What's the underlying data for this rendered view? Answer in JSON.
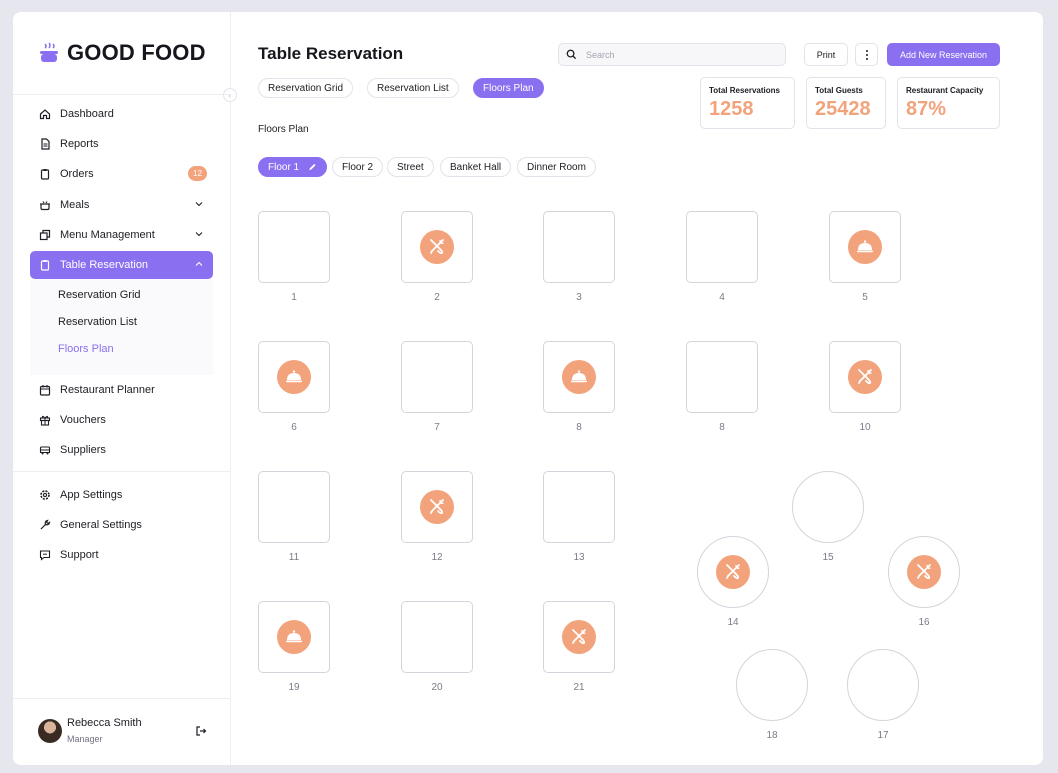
{
  "brand": {
    "name": "GOOD FOOD"
  },
  "sidebar": {
    "items": [
      {
        "label": "Dashboard",
        "icon": "home-icon"
      },
      {
        "label": "Reports",
        "icon": "file-icon"
      },
      {
        "label": "Orders",
        "icon": "clipboard-icon",
        "badge": "12"
      },
      {
        "label": "Meals",
        "icon": "pot-icon"
      },
      {
        "label": "Menu Management",
        "icon": "copy-icon"
      },
      {
        "label": "Table Reservation",
        "icon": "clipboard-icon",
        "active": true
      },
      {
        "label": "Restaurant Planner",
        "icon": "calendar-icon"
      },
      {
        "label": "Vouchers",
        "icon": "gift-icon"
      },
      {
        "label": "Suppliers",
        "icon": "truck-icon"
      },
      {
        "label": "App Settings",
        "icon": "gear-icon"
      },
      {
        "label": "General Settings",
        "icon": "wrench-icon"
      },
      {
        "label": "Support",
        "icon": "chat-icon"
      }
    ],
    "submenu": [
      {
        "label": "Reservation Grid"
      },
      {
        "label": "Reservation List"
      },
      {
        "label": "Floors Plan",
        "active": true
      }
    ]
  },
  "user": {
    "name": "Rebecca Smith",
    "role": "Manager"
  },
  "header": {
    "title": "Table Reservation",
    "search_placeholder": "Search",
    "print_label": "Print",
    "add_label": "Add New Reservation"
  },
  "view_tabs": [
    "Reservation Grid",
    "Reservation List",
    "Floors Plan"
  ],
  "active_view": "Floors Plan",
  "stats": [
    {
      "label": "Total Reservations",
      "value": "1258"
    },
    {
      "label": "Total Guests",
      "value": "25428"
    },
    {
      "label": "Restaurant Capacity",
      "value": "87%"
    }
  ],
  "section_label": "Floors Plan",
  "floors": [
    "Floor 1",
    "Floor 2",
    "Street",
    "Banket Hall",
    "Dinner Room"
  ],
  "active_floor": "Floor 1",
  "colors": {
    "accent": "#8a6ff0",
    "orange": "#f2a37c"
  },
  "tables": [
    {
      "label": "1",
      "shape": "square",
      "status": "free"
    },
    {
      "label": "2",
      "shape": "square",
      "status": "utensils"
    },
    {
      "label": "3",
      "shape": "square",
      "status": "free"
    },
    {
      "label": "4",
      "shape": "square",
      "status": "free"
    },
    {
      "label": "5",
      "shape": "square",
      "status": "cloche"
    },
    {
      "label": "6",
      "shape": "square",
      "status": "cloche"
    },
    {
      "label": "7",
      "shape": "square",
      "status": "free"
    },
    {
      "label": "8",
      "shape": "square",
      "status": "cloche"
    },
    {
      "label": "8",
      "shape": "square",
      "status": "free"
    },
    {
      "label": "10",
      "shape": "square",
      "status": "utensils"
    },
    {
      "label": "11",
      "shape": "square",
      "status": "free"
    },
    {
      "label": "12",
      "shape": "square",
      "status": "utensils"
    },
    {
      "label": "13",
      "shape": "square",
      "status": "free"
    },
    {
      "label": "19",
      "shape": "square",
      "status": "cloche"
    },
    {
      "label": "20",
      "shape": "square",
      "status": "free"
    },
    {
      "label": "21",
      "shape": "square",
      "status": "utensils"
    },
    {
      "label": "15",
      "shape": "round",
      "status": "free"
    },
    {
      "label": "14",
      "shape": "round",
      "status": "utensils"
    },
    {
      "label": "16",
      "shape": "round",
      "status": "utensils"
    },
    {
      "label": "18",
      "shape": "round",
      "status": "free"
    },
    {
      "label": "17",
      "shape": "round",
      "status": "free"
    }
  ]
}
